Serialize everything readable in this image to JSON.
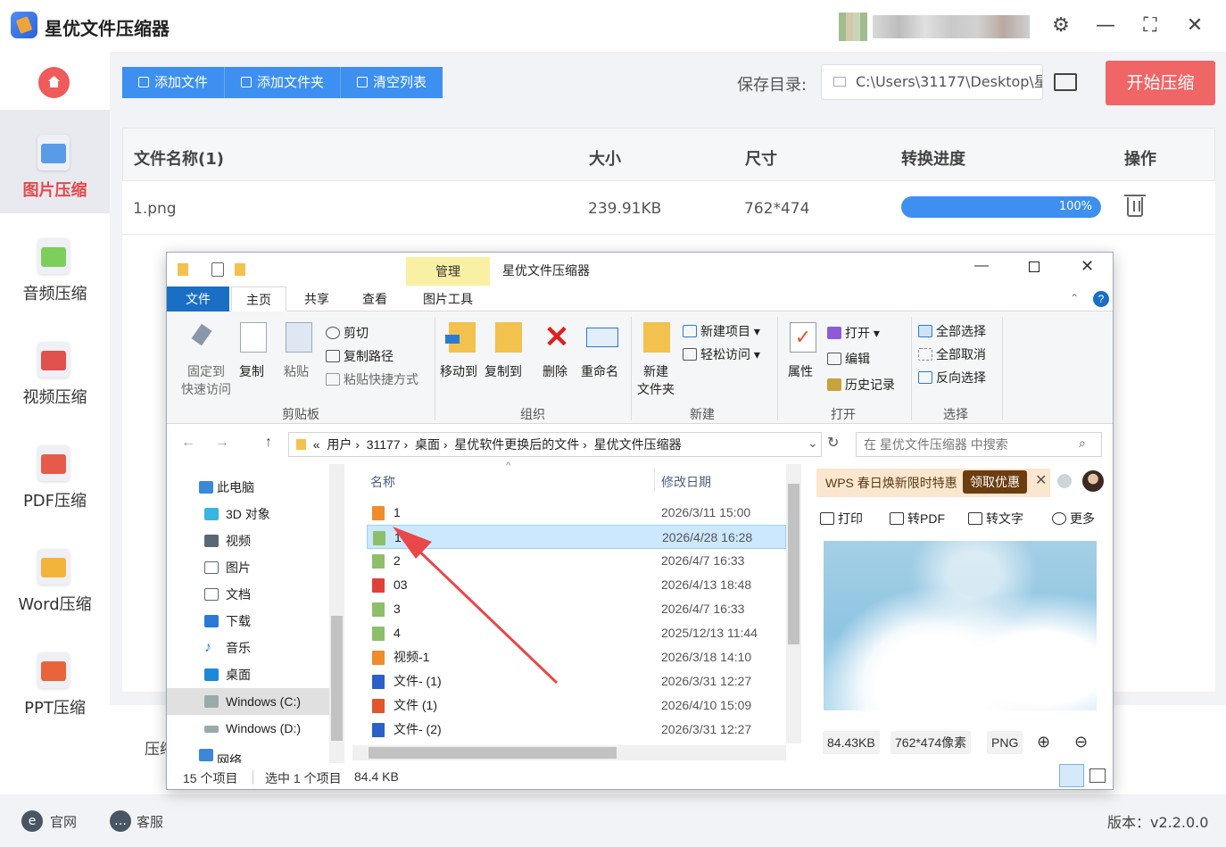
{
  "app": {
    "title": "星优文件压缩器",
    "version": "版本：v2.2.0.0",
    "accent": "#f06565",
    "primary": "#3d8ff0"
  },
  "window_controls": {
    "settings": "⚙",
    "minimize": "—",
    "maximize": "⛶",
    "close": "✕"
  },
  "sidebar": {
    "items": [
      {
        "label": "图片压缩",
        "icon": "image-icon",
        "color": "#5a9be8"
      },
      {
        "label": "音频压缩",
        "icon": "audio-icon",
        "color": "#7ccf5a"
      },
      {
        "label": "视频压缩",
        "icon": "video-icon",
        "color": "#e0504c"
      },
      {
        "label": "PDF压缩",
        "icon": "pdf-icon",
        "color": "#e65a4a"
      },
      {
        "label": "Word压缩",
        "icon": "word-icon",
        "color": "#f2b43a"
      },
      {
        "label": "PPT压缩",
        "icon": "ppt-icon",
        "color": "#e8643a"
      }
    ]
  },
  "toolbar": {
    "add_file": "添加文件",
    "add_folder": "添加文件夹",
    "clear_list": "清空列表",
    "save_label": "保存目录:",
    "save_path": "C:\\Users\\31177\\Desktop\\星",
    "start": "开始压缩"
  },
  "table": {
    "headers": [
      "文件名称(1)",
      "大小",
      "尺寸",
      "转换进度",
      "操作"
    ],
    "rows": [
      {
        "name": "1.png",
        "size": "239.91KB",
        "dims": "762*474",
        "progress_text": "100%",
        "progress": 1.0
      }
    ]
  },
  "bottom": {
    "compress_label": "压缩"
  },
  "footer": {
    "website": "官网",
    "support": "客服"
  },
  "explorer": {
    "title": "星优文件压缩器",
    "manage_tab": "管理",
    "tabs": [
      "文件",
      "主页",
      "共享",
      "查看",
      "图片工具"
    ],
    "ribbon": {
      "pin": "固定到\n快速访问",
      "copy": "复制",
      "paste": "粘贴",
      "cut": "剪切",
      "copy_path": "复制路径",
      "paste_shortcut": "粘贴快捷方式",
      "move_to": "移动到",
      "copy_to": "复制到",
      "delete": "删除",
      "rename": "重命名",
      "new_folder": "新建\n文件夹",
      "new_item": "新建项目",
      "easy_access": "轻松访问",
      "properties": "属性",
      "open": "打开",
      "edit": "编辑",
      "history": "历史记录",
      "select_all": "全部选择",
      "select_none": "全部取消",
      "invert": "反向选择",
      "groups": [
        "剪贴板",
        "组织",
        "新建",
        "打开",
        "选择"
      ]
    },
    "breadcrumb": [
      "«",
      "用户",
      "31177",
      "桌面",
      "星优软件更换后的文件",
      "星优文件压缩器"
    ],
    "search_placeholder": "在 星优文件压缩器 中搜索",
    "nav": [
      "此电脑",
      "3D 对象",
      "视频",
      "图片",
      "文档",
      "下载",
      "音乐",
      "桌面",
      "Windows (C:)",
      "Windows (D:)",
      "网络"
    ],
    "columns": {
      "name": "名称",
      "date": "修改日期"
    },
    "files": [
      {
        "name": "1",
        "date": "2026/3/11 15:00",
        "icon_color": "#f08c2a"
      },
      {
        "name": "1",
        "date": "2026/4/28 16:28",
        "icon_color": "#8dbf6a"
      },
      {
        "name": "2",
        "date": "2026/4/7 16:33",
        "icon_color": "#8dbf6a"
      },
      {
        "name": "03",
        "date": "2026/4/13 18:48",
        "icon_color": "#e0403a"
      },
      {
        "name": "3",
        "date": "2026/4/7 16:33",
        "icon_color": "#8dbf6a"
      },
      {
        "name": "4",
        "date": "2025/12/13 11:44",
        "icon_color": "#8dbf6a"
      },
      {
        "name": "视频-1",
        "date": "2026/3/18 14:10",
        "icon_color": "#f08c2a"
      },
      {
        "name": "文件- (1)",
        "date": "2026/3/31 12:27",
        "icon_color": "#2b5fc9"
      },
      {
        "name": "文件 (1)",
        "date": "2026/4/10 15:09",
        "icon_color": "#e0562a"
      },
      {
        "name": "文件- (2)",
        "date": "2026/3/31 12:27",
        "icon_color": "#2b5fc9"
      }
    ],
    "preview": {
      "wps_ad": "WPS 春日焕新限时特惠",
      "wps_btn": "领取优惠",
      "print": "打印",
      "to_pdf": "转PDF",
      "to_text": "转文字",
      "more": "更多",
      "size": "84.43KB",
      "dims": "762*474像素",
      "format": "PNG"
    },
    "status": {
      "count": "15 个项目",
      "selected": "选中 1 个项目",
      "selected_size": "84.4 KB"
    }
  }
}
